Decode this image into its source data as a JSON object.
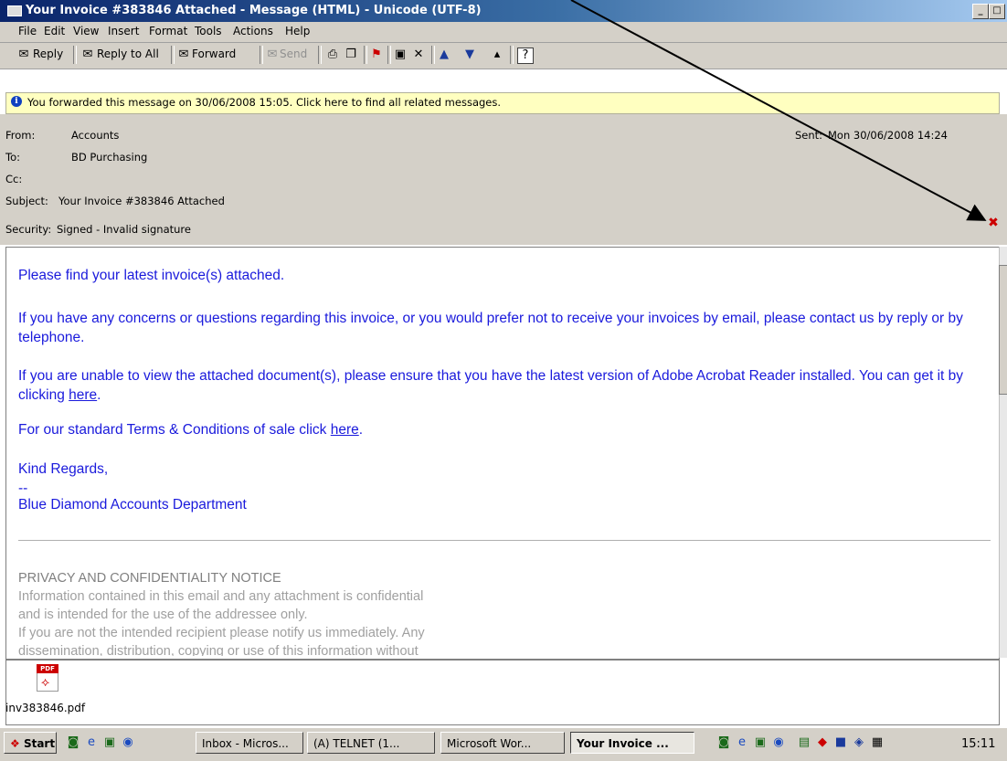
{
  "window": {
    "title": "Your Invoice #383846 Attached - Message (HTML) - Unicode (UTF-8)",
    "min_label": "_",
    "max_label": "□",
    "close_label": "x"
  },
  "menu": [
    "File",
    "Edit",
    "View",
    "Insert",
    "Format",
    "Tools",
    "Actions",
    "Help"
  ],
  "toolbar": {
    "reply": "Reply",
    "reply_all": "Reply to All",
    "forward": "Forward",
    "send": "Send"
  },
  "infobar": {
    "text": "You forwarded this message on 30/06/2008 15:05. Click here to find all related messages."
  },
  "header": {
    "from_label": "From:",
    "from": "Accounts",
    "to_label": "To:",
    "to": "BD Purchasing",
    "cc_label": "Cc:",
    "cc": "",
    "subject_label": "Subject:",
    "subject": "Your Invoice #383846 Attached",
    "security_label": "Security:",
    "security": "Signed - Invalid signature",
    "sent_label": "Sent:",
    "sent": "Mon 30/06/2008 14:24"
  },
  "body": {
    "p1": "Please find your latest invoice(s) attached.",
    "p2": "If you have any concerns or questions regarding this invoice, or you would prefer not to receive your invoices by email, please contact us by reply or by telephone.",
    "p3": "If you are unable to view the attached document(s), please ensure that you have the latest version of Adobe Acrobat Reader installed. You can get it by clicking",
    "p3_link": "here",
    "p4": "For our standard Terms & Conditions of sale click",
    "p4_link": "here",
    "regards": "Kind Regards,",
    "dash": "--",
    "signature": "Blue Diamond Accounts Department",
    "notice_title": "PRIVACY AND CONFIDENTIALITY NOTICE",
    "notice_lines": [
      "Information contained in this email and any attachment is confidential",
      "and is intended for the use of the addressee only.",
      "If you are not the intended recipient please notify us immediately. Any",
      "dissemination, distribution, copying or use of this information without"
    ]
  },
  "attachment": {
    "filename": "inv383846.pdf",
    "icon_label": "PDF"
  },
  "taskbar": {
    "start": "Start",
    "tasks": [
      "Inbox - Micros...",
      "(A) TELNET (1...",
      "Microsoft Wor...",
      "Your Invoice ..."
    ],
    "clock": "15:11"
  },
  "colors": {
    "body_text": "#1a1adc",
    "notice_text": "#a0a0a0",
    "infobar_bg": "#ffffc0",
    "chrome": "#d4d0c8"
  }
}
